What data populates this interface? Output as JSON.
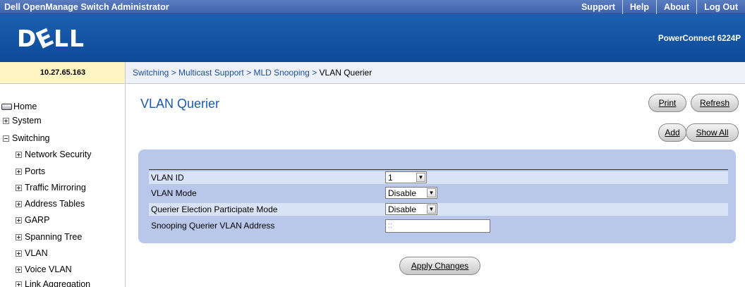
{
  "topbar": {
    "title": "Dell OpenManage Switch Administrator",
    "links": [
      "Support",
      "Help",
      "About",
      "Log Out"
    ]
  },
  "brand": {
    "logo": "DELL",
    "model": "PowerConnect 6224P"
  },
  "ip_address": "10.27.65.163",
  "breadcrumb": {
    "items": [
      "Switching",
      "Multicast Support",
      "MLD Snooping"
    ],
    "current": "VLAN Querier",
    "separator": ">"
  },
  "nav": {
    "home": "Home",
    "system": "System",
    "switching": "Switching",
    "children": [
      "Network Security",
      "Ports",
      "Traffic Mirroring",
      "Address Tables",
      "GARP",
      "Spanning Tree",
      "VLAN",
      "Voice VLAN",
      "Link Aggregation"
    ]
  },
  "page": {
    "title": "VLAN Querier",
    "buttons": {
      "print": "Print",
      "refresh": "Refresh",
      "add": "Add",
      "show_all": "Show All",
      "apply": "Apply Changes"
    }
  },
  "form": {
    "vlan_id": {
      "label": "VLAN ID",
      "value": "1"
    },
    "vlan_mode": {
      "label": "VLAN Mode",
      "value": "Disable"
    },
    "querier_election": {
      "label": "Querier Election Participate Mode",
      "value": "Disable"
    },
    "snooping_address": {
      "label": "Snooping Querier VLAN Address",
      "value": "::"
    }
  },
  "colors": {
    "top_bar": "#4a6fb8",
    "brand_bar": "#1456a6",
    "panel": "#b9c8ea",
    "title": "#1c5aa8"
  }
}
